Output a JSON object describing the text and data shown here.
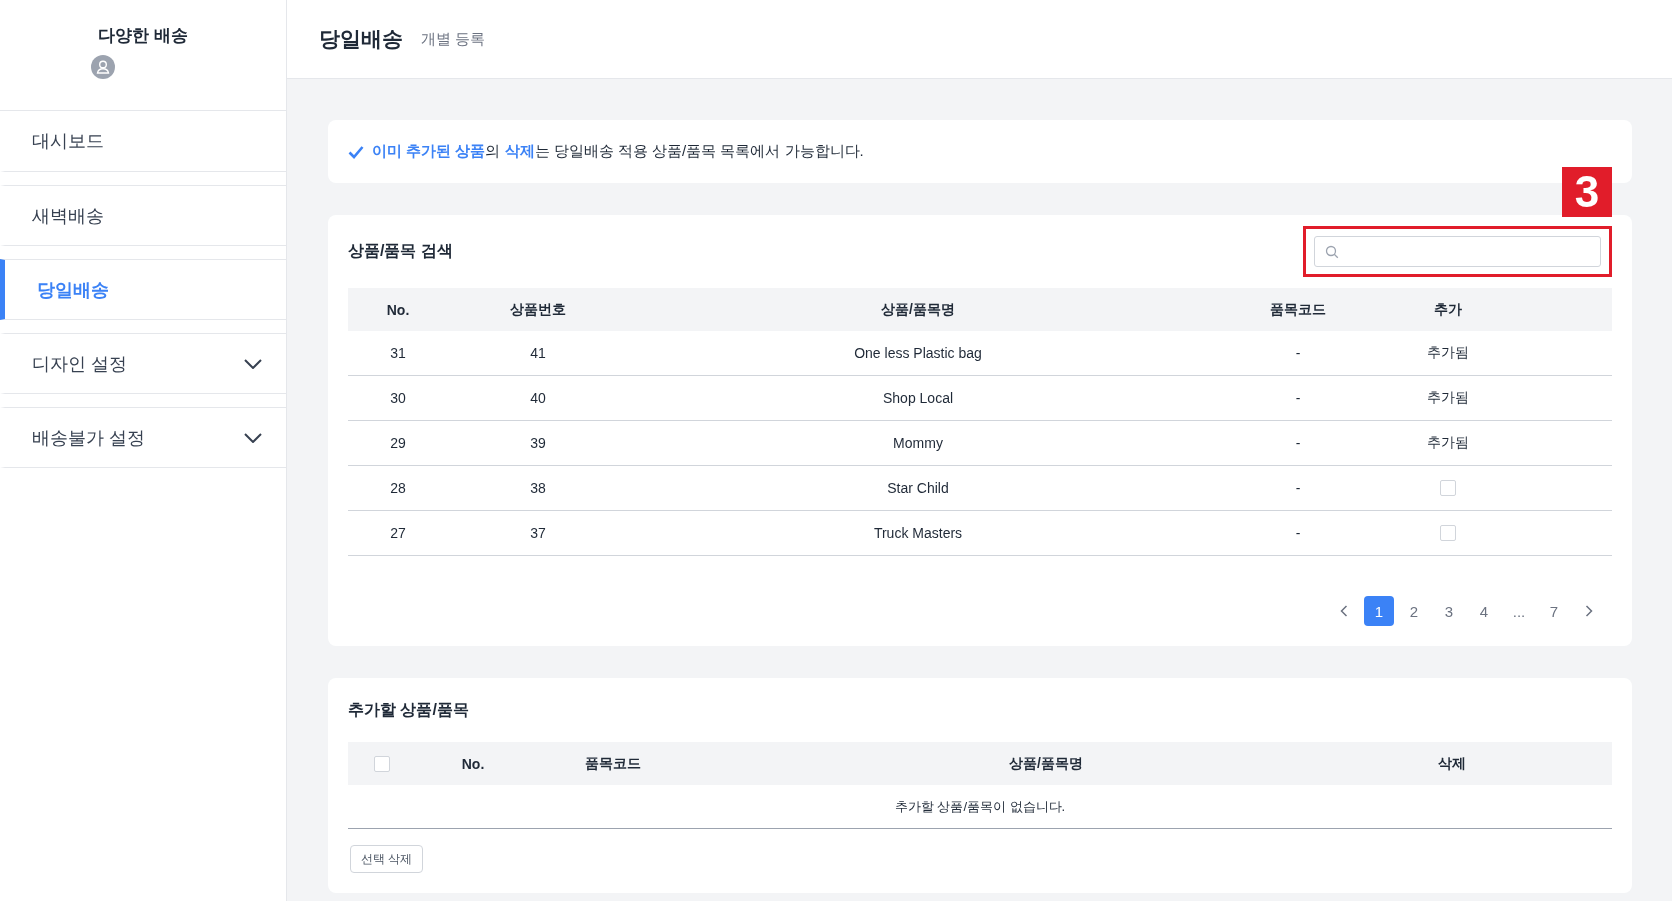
{
  "sidebar": {
    "title": "다양한 배송",
    "items": [
      {
        "label": "대시보드",
        "selected": false,
        "expandable": false
      },
      {
        "label": "새벽배송",
        "selected": false,
        "expandable": false
      },
      {
        "label": "당일배송",
        "selected": true,
        "expandable": false
      },
      {
        "label": "디자인 설정",
        "selected": false,
        "expandable": true
      },
      {
        "label": "배송불가 설정",
        "selected": false,
        "expandable": true
      }
    ]
  },
  "header": {
    "title": "당일배송",
    "subtitle": "개별 등록"
  },
  "notice": "**이미 추가된 상품**의 **삭제**는 당일배송 적용 상품/품목 목록에서 가능합니다.",
  "search_panel": {
    "title": "상품/품목 검색",
    "annotation": "3",
    "columns": [
      "No.",
      "상품번호",
      "상품/품목명",
      "품목코드",
      "추가"
    ],
    "rows": [
      {
        "no": "31",
        "product_no": "41",
        "name": "One less Plastic bag",
        "code": "-",
        "add": {
          "kind": "added",
          "label": "추가됨"
        }
      },
      {
        "no": "30",
        "product_no": "40",
        "name": "Shop Local",
        "code": "-",
        "add": {
          "kind": "added",
          "label": "추가됨"
        }
      },
      {
        "no": "29",
        "product_no": "39",
        "name": "Mommy",
        "code": "-",
        "add": {
          "kind": "added",
          "label": "추가됨"
        }
      },
      {
        "no": "28",
        "product_no": "38",
        "name": "Star Child",
        "code": "-",
        "add": {
          "kind": "checkbox",
          "checked": false
        }
      },
      {
        "no": "27",
        "product_no": "37",
        "name": "Truck Masters",
        "code": "-",
        "add": {
          "kind": "checkbox",
          "checked": false
        }
      }
    ],
    "pagination": {
      "pages": [
        {
          "label": "1",
          "selected": true
        },
        {
          "label": "2",
          "selected": false
        },
        {
          "label": "3",
          "selected": false
        },
        {
          "label": "4",
          "selected": false
        },
        {
          "label": "...",
          "selected": false
        },
        {
          "label": "7",
          "selected": false
        }
      ]
    }
  },
  "add_panel": {
    "title": "추가할 상품/품목",
    "select_all_checked": false,
    "columns": [
      "No.",
      "품목코드",
      "상품/품목명",
      "삭제"
    ],
    "empty_message": "추가할 상품/품목이 없습니다.",
    "delete_button": "선택 삭제"
  }
}
